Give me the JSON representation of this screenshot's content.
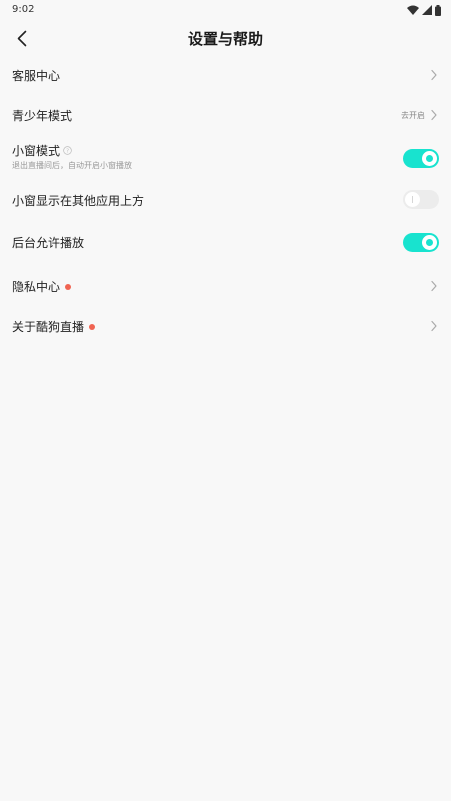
{
  "status_bar": {
    "time": "9:02",
    "icons": [
      "wifi-icon",
      "signal-icon",
      "battery-icon"
    ]
  },
  "header": {
    "title": "设置与帮助",
    "back_icon": "chevron-left-icon"
  },
  "settings": {
    "customer_service": {
      "label": "客服中心"
    },
    "teen_mode": {
      "label": "青少年模式",
      "value": "去开启"
    },
    "mini_window": {
      "label": "小窗模式",
      "description": "退出直播间后，自动开启小窗播放",
      "enabled": true
    },
    "overlay": {
      "label": "小窗显示在其他应用上方",
      "enabled": false
    },
    "background_play": {
      "label": "后台允许播放",
      "enabled": true
    },
    "privacy": {
      "label": "隐私中心",
      "has_badge": true
    },
    "about": {
      "label": "关于酷狗直播",
      "has_badge": true
    }
  },
  "colors": {
    "accent": "#18e3cf",
    "badge": "#f06452",
    "background": "#f8f8f8"
  }
}
